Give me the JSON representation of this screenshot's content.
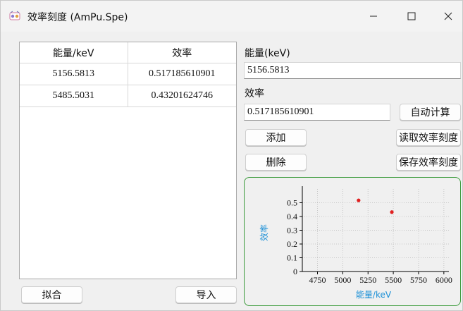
{
  "window": {
    "title": "效率刻度 (AmPu.Spe)",
    "minimize_glyph": "—",
    "maximize_glyph": "☐",
    "close_glyph": "✕"
  },
  "table": {
    "columns": [
      "能量/keV",
      "效率"
    ],
    "rows": [
      [
        "5156.5813",
        "0.517185610901"
      ],
      [
        "5485.5031",
        "0.43201624746"
      ]
    ]
  },
  "form": {
    "energy_label": "能量(keV)",
    "energy_value": "5156.5813",
    "efficiency_label": "效率",
    "efficiency_value": "0.517185610901",
    "auto_calc_label": "自动计算",
    "add_label": "添加",
    "delete_label": "删除",
    "read_label": "读取效率刻度",
    "save_label": "保存效率刻度",
    "fit_label": "拟合",
    "import_label": "导入"
  },
  "chart_data": {
    "type": "scatter",
    "xlabel": "能量/keV",
    "ylabel": "效率",
    "xlim": [
      4600,
      6050
    ],
    "ylim": [
      0,
      0.6
    ],
    "xticks": [
      4750,
      5000,
      5250,
      5500,
      5750,
      6000
    ],
    "yticks": [
      0,
      0.1,
      0.2,
      0.3,
      0.4,
      0.5
    ],
    "grid": true,
    "point_color": "#e02020",
    "series": [
      {
        "x": [
          5156.5813,
          5485.5031
        ],
        "y": [
          0.517185610901,
          0.43201624746
        ]
      }
    ]
  },
  "colors": {
    "axis_label": "#1a8fd6",
    "frame": "#3a9a3a"
  }
}
